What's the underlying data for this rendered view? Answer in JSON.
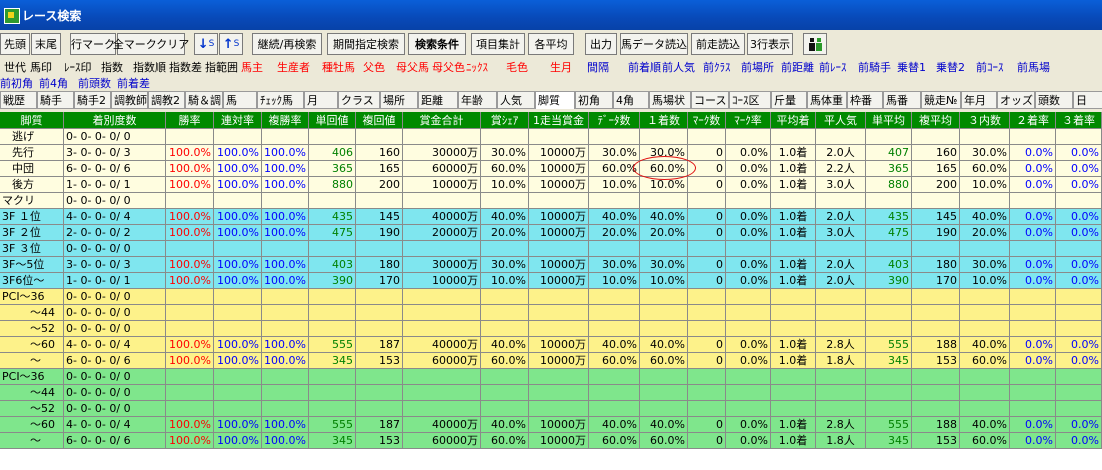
{
  "window": {
    "title": "レース検索"
  },
  "toolbar": {
    "buttons": [
      "先頭",
      "末尾",
      "行マーク",
      "全マーククリア",
      "継続/再検索",
      "期間指定検索",
      "検索条件",
      "項目集計",
      "各平均",
      "出力",
      "馬データ読込",
      "前走読込",
      "3行表示"
    ],
    "sort_desc_label": "S",
    "sort_asc_label": "S",
    "sort_desc_arrow": "↓",
    "sort_asc_arrow": "↑"
  },
  "tabs_row2": [
    {
      "label": "世代",
      "color": "#000000"
    },
    {
      "label": "馬印",
      "color": "#000000"
    },
    {
      "label": "ﾚｰｽ印",
      "color": "#000000"
    },
    {
      "label": "指数",
      "color": "#000000"
    },
    {
      "label": "指数順",
      "color": "#000000"
    },
    {
      "label": "指数差",
      "color": "#000000"
    },
    {
      "label": "指範囲",
      "color": "#000000"
    },
    {
      "label": "馬主",
      "color": "#ff0000"
    },
    {
      "label": "生産者",
      "color": "#ff0000"
    },
    {
      "label": "種牡馬",
      "color": "#ff0000"
    },
    {
      "label": "父色",
      "color": "#ff0000"
    },
    {
      "label": "母父馬",
      "color": "#ff0000"
    },
    {
      "label": "母父色",
      "color": "#ff0000"
    },
    {
      "label": "ﾆｯｸｽ",
      "color": "#ff0000"
    },
    {
      "label": "毛色",
      "color": "#ff0000"
    },
    {
      "label": "生月",
      "color": "#ff0000"
    },
    {
      "label": "間隔",
      "color": "#0000cc"
    },
    {
      "label": "前着順",
      "color": "#0000cc"
    },
    {
      "label": "前人気",
      "color": "#0000cc"
    },
    {
      "label": "前ｸﾗｽ",
      "color": "#0000cc"
    },
    {
      "label": "前場所",
      "color": "#0000cc"
    },
    {
      "label": "前距離",
      "color": "#0000cc"
    },
    {
      "label": "前ﾚｰｽ",
      "color": "#0000cc"
    },
    {
      "label": "前騎手",
      "color": "#0000cc"
    },
    {
      "label": "乗替1",
      "color": "#0000cc"
    },
    {
      "label": "乗替2",
      "color": "#0000cc"
    },
    {
      "label": "前ｺｰｽ",
      "color": "#0000cc"
    },
    {
      "label": "前馬場",
      "color": "#0000cc"
    }
  ],
  "tabs_row3": [
    {
      "label": "前初角",
      "color": "#0000cc"
    },
    {
      "label": "前4角",
      "color": "#0000cc"
    },
    {
      "label": "前頭数",
      "color": "#0000cc"
    },
    {
      "label": "前着差",
      "color": "#0000cc"
    }
  ],
  "tabs_row4": [
    "戦歴",
    "騎手",
    "騎手2",
    "調教師",
    "調教2",
    "騎＆調",
    "馬",
    "ﾁｪｯｸ馬",
    "月",
    "クラス",
    "場所",
    "距離",
    "年齢",
    "人気",
    "脚質",
    "初角",
    "4角",
    "馬場状",
    "コース",
    "ｺｰｽ区",
    "斤量",
    "馬体重",
    "枠番",
    "馬番",
    "競走№",
    "年月",
    "オッズ",
    "頭数",
    "日"
  ],
  "selected_tab": "脚質",
  "table": {
    "columns": [
      "脚質",
      "着別度数",
      "勝率",
      "連対率",
      "複勝率",
      "単回値",
      "複回値",
      "賞金合計",
      "賞ｼｪｱ",
      "1走当賞金",
      "ﾃﾞｰﾀ数",
      "１着数",
      "ﾏｰｸ数",
      "ﾏｰｸ率",
      "平均着",
      "平人気",
      "単平均",
      "複平均",
      "３内数",
      "２着率",
      "３着率"
    ],
    "rows": [
      {
        "bg": "#fffde0",
        "cells": [
          "逃げ",
          "0- 0- 0- 0/ 0",
          "",
          "",
          "",
          "",
          "",
          "",
          "",
          "",
          "",
          "",
          "",
          "",
          "",
          "",
          "",
          "",
          "",
          "",
          ""
        ]
      },
      {
        "bg": "#fffde0",
        "cells": [
          "先行",
          "3- 0- 0- 0/ 3",
          "100.0%",
          "100.0%",
          "100.0%",
          "406",
          "160",
          "30000万",
          "30.0%",
          "10000万",
          "30.0%",
          "30.0%",
          "0",
          "0.0%",
          "1.0着",
          "2.0人",
          "407",
          "160",
          "30.0%",
          "0.0%",
          "0.0%"
        ]
      },
      {
        "bg": "#fffde0",
        "cells": [
          "中団",
          "6- 0- 0- 0/ 6",
          "100.0%",
          "100.0%",
          "100.0%",
          "365",
          "165",
          "60000万",
          "60.0%",
          "10000万",
          "60.0%",
          "60.0%",
          "0",
          "0.0%",
          "1.0着",
          "2.2人",
          "365",
          "165",
          "60.0%",
          "0.0%",
          "0.0%"
        ]
      },
      {
        "bg": "#fffde0",
        "cells": [
          "後方",
          "1- 0- 0- 0/ 1",
          "100.0%",
          "100.0%",
          "100.0%",
          "880",
          "200",
          "10000万",
          "10.0%",
          "10000万",
          "10.0%",
          "10.0%",
          "0",
          "0.0%",
          "1.0着",
          "3.0人",
          "880",
          "200",
          "10.0%",
          "0.0%",
          "0.0%"
        ]
      },
      {
        "bg": "#fffde0",
        "cells": [
          "マクリ",
          "0- 0- 0- 0/ 0",
          "",
          "",
          "",
          "",
          "",
          "",
          "",
          "",
          "",
          "",
          "",
          "",
          "",
          "",
          "",
          "",
          "",
          "",
          ""
        ]
      },
      {
        "bg": "#7fe6ef",
        "cells": [
          "3F １位",
          "4- 0- 0- 0/ 4",
          "100.0%",
          "100.0%",
          "100.0%",
          "435",
          "145",
          "40000万",
          "40.0%",
          "10000万",
          "40.0%",
          "40.0%",
          "0",
          "0.0%",
          "1.0着",
          "2.0人",
          "435",
          "145",
          "40.0%",
          "0.0%",
          "0.0%"
        ]
      },
      {
        "bg": "#7fe6ef",
        "cells": [
          "3F ２位",
          "2- 0- 0- 0/ 2",
          "100.0%",
          "100.0%",
          "100.0%",
          "475",
          "190",
          "20000万",
          "20.0%",
          "10000万",
          "20.0%",
          "20.0%",
          "0",
          "0.0%",
          "1.0着",
          "3.0人",
          "475",
          "190",
          "20.0%",
          "0.0%",
          "0.0%"
        ]
      },
      {
        "bg": "#7fe6ef",
        "cells": [
          "3F ３位",
          "0- 0- 0- 0/ 0",
          "",
          "",
          "",
          "",
          "",
          "",
          "",
          "",
          "",
          "",
          "",
          "",
          "",
          "",
          "",
          "",
          "",
          "",
          ""
        ]
      },
      {
        "bg": "#7fe6ef",
        "cells": [
          "3F～5位",
          "3- 0- 0- 0/ 3",
          "100.0%",
          "100.0%",
          "100.0%",
          "403",
          "180",
          "30000万",
          "30.0%",
          "10000万",
          "30.0%",
          "30.0%",
          "0",
          "0.0%",
          "1.0着",
          "2.0人",
          "403",
          "180",
          "30.0%",
          "0.0%",
          "0.0%"
        ]
      },
      {
        "bg": "#7fe6ef",
        "cells": [
          "3F6位～",
          "1- 0- 0- 0/ 1",
          "100.0%",
          "100.0%",
          "100.0%",
          "390",
          "170",
          "10000万",
          "10.0%",
          "10000万",
          "10.0%",
          "10.0%",
          "0",
          "0.0%",
          "1.0着",
          "2.0人",
          "390",
          "170",
          "10.0%",
          "0.0%",
          "0.0%"
        ]
      },
      {
        "bg": "#fdf28a",
        "cells": [
          "PCI～36",
          "0- 0- 0- 0/ 0",
          "",
          "",
          "",
          "",
          "",
          "",
          "",
          "",
          "",
          "",
          "",
          "",
          "",
          "",
          "",
          "",
          "",
          "",
          ""
        ]
      },
      {
        "bg": "#fdf28a",
        "cells": [
          "～44",
          "0- 0- 0- 0/ 0",
          "",
          "",
          "",
          "",
          "",
          "",
          "",
          "",
          "",
          "",
          "",
          "",
          "",
          "",
          "",
          "",
          "",
          "",
          ""
        ]
      },
      {
        "bg": "#fdf28a",
        "cells": [
          "～52",
          "0- 0- 0- 0/ 0",
          "",
          "",
          "",
          "",
          "",
          "",
          "",
          "",
          "",
          "",
          "",
          "",
          "",
          "",
          "",
          "",
          "",
          "",
          ""
        ]
      },
      {
        "bg": "#fdf28a",
        "cells": [
          "～60",
          "4- 0- 0- 0/ 4",
          "100.0%",
          "100.0%",
          "100.0%",
          "555",
          "187",
          "40000万",
          "40.0%",
          "10000万",
          "40.0%",
          "40.0%",
          "0",
          "0.0%",
          "1.0着",
          "2.8人",
          "555",
          "188",
          "40.0%",
          "0.0%",
          "0.0%"
        ]
      },
      {
        "bg": "#fdf28a",
        "cells": [
          "～",
          "6- 0- 0- 0/ 6",
          "100.0%",
          "100.0%",
          "100.0%",
          "345",
          "153",
          "60000万",
          "60.0%",
          "10000万",
          "60.0%",
          "60.0%",
          "0",
          "0.0%",
          "1.0着",
          "1.8人",
          "345",
          "153",
          "60.0%",
          "0.0%",
          "0.0%"
        ]
      },
      {
        "bg": "#7fe68c",
        "cells": [
          "PCI～36",
          "0- 0- 0- 0/ 0",
          "",
          "",
          "",
          "",
          "",
          "",
          "",
          "",
          "",
          "",
          "",
          "",
          "",
          "",
          "",
          "",
          "",
          "",
          ""
        ]
      },
      {
        "bg": "#7fe68c",
        "cells": [
          "～44",
          "0- 0- 0- 0/ 0",
          "",
          "",
          "",
          "",
          "",
          "",
          "",
          "",
          "",
          "",
          "",
          "",
          "",
          "",
          "",
          "",
          "",
          "",
          ""
        ]
      },
      {
        "bg": "#7fe68c",
        "cells": [
          "～52",
          "0- 0- 0- 0/ 0",
          "",
          "",
          "",
          "",
          "",
          "",
          "",
          "",
          "",
          "",
          "",
          "",
          "",
          "",
          "",
          "",
          "",
          "",
          ""
        ]
      },
      {
        "bg": "#7fe68c",
        "cells": [
          "～60",
          "4- 0- 0- 0/ 4",
          "100.0%",
          "100.0%",
          "100.0%",
          "555",
          "187",
          "40000万",
          "40.0%",
          "10000万",
          "40.0%",
          "40.0%",
          "0",
          "0.0%",
          "1.0着",
          "2.8人",
          "555",
          "188",
          "40.0%",
          "0.0%",
          "0.0%"
        ]
      },
      {
        "bg": "#7fe68c",
        "cells": [
          "～",
          "6- 0- 0- 0/ 6",
          "100.0%",
          "100.0%",
          "100.0%",
          "345",
          "153",
          "60000万",
          "60.0%",
          "10000万",
          "60.0%",
          "60.0%",
          "0",
          "0.0%",
          "1.0着",
          "1.8人",
          "345",
          "153",
          "60.0%",
          "0.0%",
          "0.0%"
        ]
      }
    ]
  },
  "highlighted_cell": {
    "row": 2,
    "column": "１着数",
    "value": "60.0%"
  }
}
